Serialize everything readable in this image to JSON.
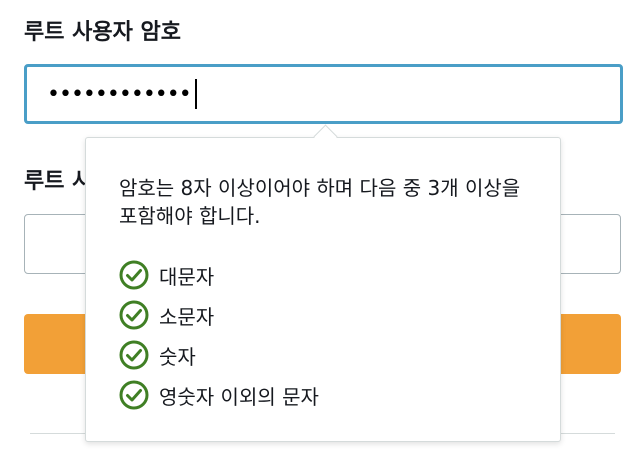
{
  "root_password": {
    "label": "루트 사용자 암호",
    "value": "••••••••••••"
  },
  "confirm_password": {
    "label": "루트 사"
  },
  "requirements_popover": {
    "description": "암호는 8자 이상이어야 하며 다음 중 3개 이상을 포함해야 합니다.",
    "items": [
      {
        "label": "대문자",
        "status": "met"
      },
      {
        "label": "소문자",
        "status": "met"
      },
      {
        "label": "숫자",
        "status": "met"
      },
      {
        "label": "영숫자 이외의 문자",
        "status": "met"
      }
    ],
    "check_color": "#3f7f24"
  },
  "colors": {
    "focus_border": "#4a9ec7",
    "primary_button": "#f2a037"
  }
}
